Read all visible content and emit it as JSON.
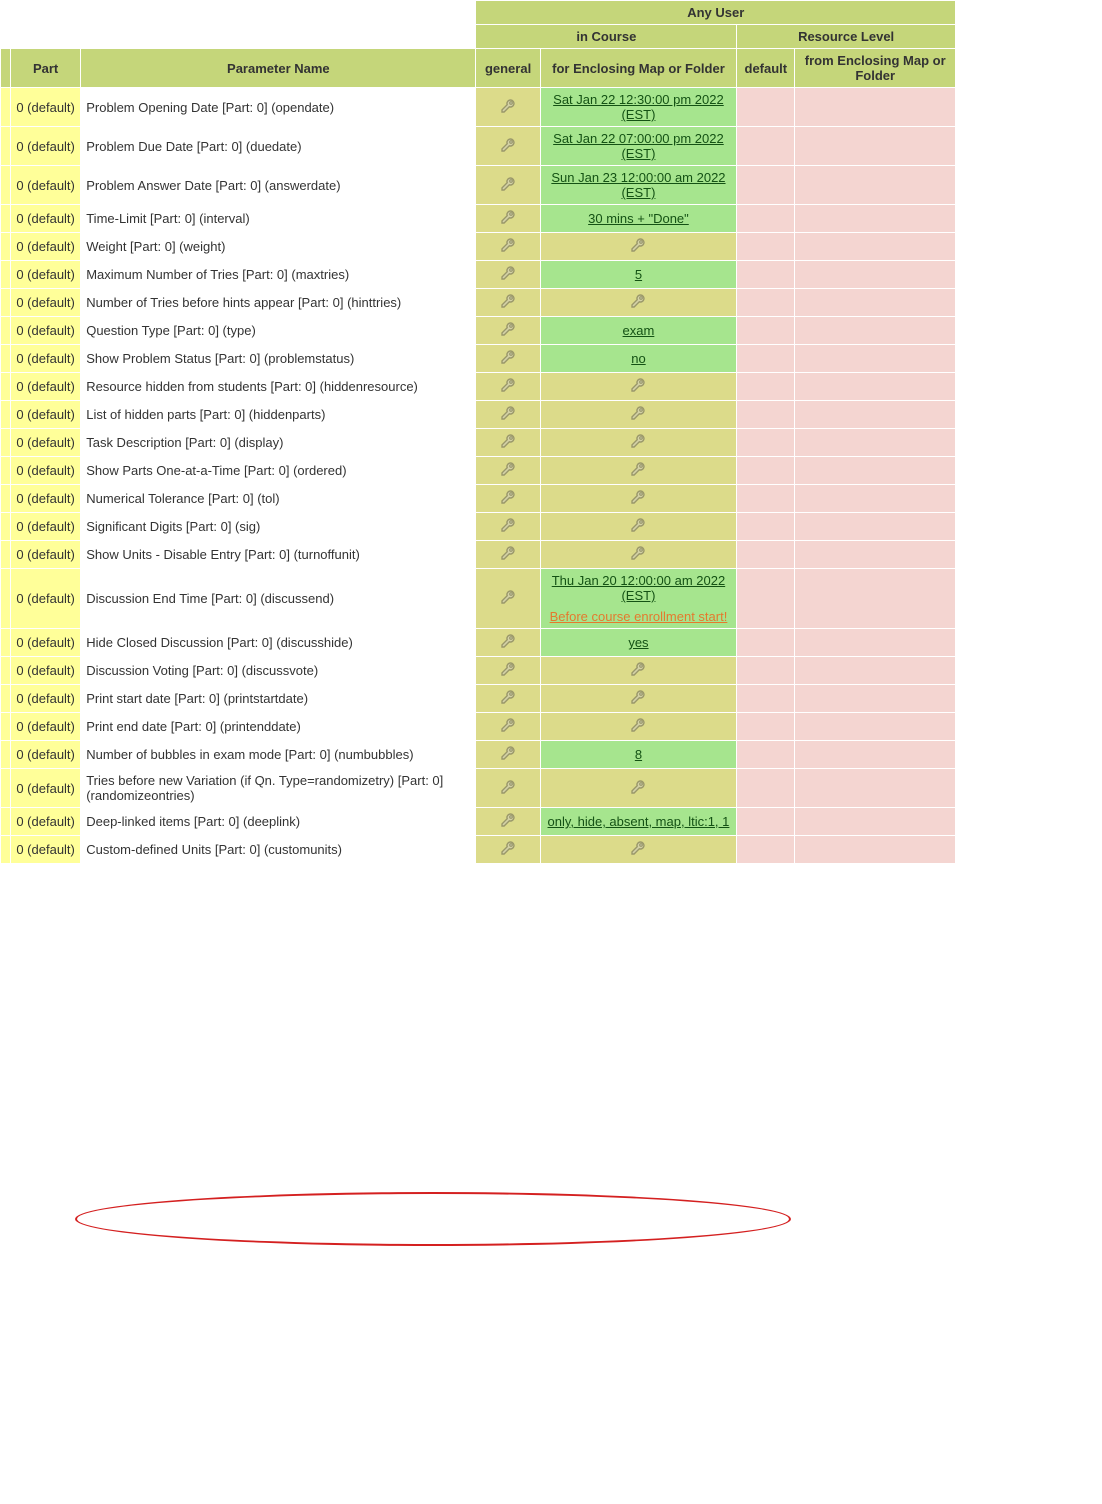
{
  "headers": {
    "any_user": "Any User",
    "in_course": "in Course",
    "resource_level": "Resource Level",
    "part": "Part",
    "parameter_name": "Parameter Name",
    "general": "general",
    "enclosing": "for Enclosing Map or Folder",
    "default": "default",
    "from_enclosing": "from Enclosing Map or Folder"
  },
  "part_label": "0 (default)",
  "rows": [
    {
      "name": "Problem Opening Date [Part: 0] (opendate)",
      "value": "Sat Jan 22 12:30:00 pm 2022 (EST)",
      "green": true
    },
    {
      "name": "Problem Due Date [Part: 0] (duedate)",
      "value": "Sat Jan 22 07:00:00 pm 2022 (EST)",
      "green": true
    },
    {
      "name": "Problem Answer Date [Part: 0] (answerdate)",
      "value": "Sun Jan 23 12:00:00 am 2022 (EST)",
      "green": true
    },
    {
      "name": "Time-Limit [Part: 0] (interval)",
      "value": "30 mins + \"Done\"",
      "green": true
    },
    {
      "name": "Weight [Part: 0] (weight)",
      "value": "",
      "green": false
    },
    {
      "name": "Maximum Number of Tries [Part: 0] (maxtries)",
      "value": "5",
      "green": true
    },
    {
      "name": "Number of Tries before hints appear [Part: 0] (hinttries)",
      "value": "",
      "green": false
    },
    {
      "name": "Question Type [Part: 0] (type)",
      "value": "exam",
      "green": true
    },
    {
      "name": "Show Problem Status [Part: 0] (problemstatus)",
      "value": "no",
      "green": true
    },
    {
      "name": "Resource hidden from students [Part: 0] (hiddenresource)",
      "value": "",
      "green": false
    },
    {
      "name": "List of hidden parts [Part: 0] (hiddenparts)",
      "value": "",
      "green": false
    },
    {
      "name": "Task Description [Part: 0] (display)",
      "value": "",
      "green": false
    },
    {
      "name": "Show Parts One-at-a-Time [Part: 0] (ordered)",
      "value": "",
      "green": false
    },
    {
      "name": "Numerical Tolerance [Part: 0] (tol)",
      "value": "",
      "green": false
    },
    {
      "name": "Significant Digits [Part: 0] (sig)",
      "value": "",
      "green": false
    },
    {
      "name": "Show Units - Disable Entry [Part: 0] (turnoffunit)",
      "value": "",
      "green": false
    },
    {
      "name": "Discussion End Time [Part: 0] (discussend)",
      "value": "Thu Jan 20 12:00:00 am 2022 (EST)",
      "warning": "Before course enrollment start!",
      "green": true
    },
    {
      "name": "Hide Closed Discussion [Part: 0] (discusshide)",
      "value": "yes",
      "green": true
    },
    {
      "name": "Discussion Voting [Part: 0] (discussvote)",
      "value": "",
      "green": false
    },
    {
      "name": "Print start date [Part: 0] (printstartdate)",
      "value": "",
      "green": false
    },
    {
      "name": "Print end date [Part: 0] (printenddate)",
      "value": "",
      "green": false
    },
    {
      "name": "Number of bubbles in exam mode [Part: 0] (numbubbles)",
      "value": "8",
      "green": true
    },
    {
      "name": "Tries before new Variation (if Qn. Type=randomizetry) [Part: 0] (randomizeontries)",
      "value": "",
      "green": false
    },
    {
      "name": "Deep-linked items [Part: 0] (deeplink)",
      "value": "only, hide, absent, map, ltic:1, 1",
      "green": true
    },
    {
      "name": "Custom-defined Units [Part: 0] (customunits)",
      "value": "",
      "green": false
    }
  ]
}
